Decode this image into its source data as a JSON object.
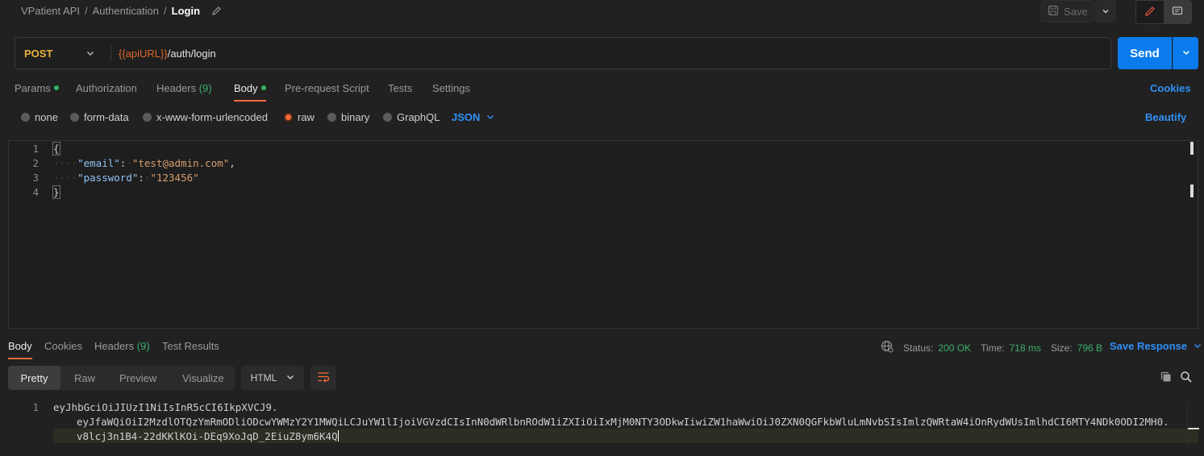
{
  "breadcrumb": {
    "workspace": "VPatient API",
    "folder": "Authentication",
    "request": "Login"
  },
  "toolbar": {
    "save_label": "Save"
  },
  "request": {
    "method": "POST",
    "url_variable": "{{apiURL}}",
    "url_path": "/auth/login",
    "send_label": "Send"
  },
  "request_tabs": {
    "params": "Params",
    "authorization": "Authorization",
    "headers": "Headers",
    "headers_count": "(9)",
    "body": "Body",
    "pre_request": "Pre-request Script",
    "tests": "Tests",
    "settings": "Settings",
    "cookies": "Cookies"
  },
  "body_types": {
    "none": "none",
    "form_data": "form-data",
    "urlencoded": "x-www-form-urlencoded",
    "raw": "raw",
    "binary": "binary",
    "graphql": "GraphQL",
    "selected": "raw",
    "language": "JSON",
    "beautify": "Beautify"
  },
  "editor": {
    "line_numbers": [
      "1",
      "2",
      "3",
      "4"
    ],
    "open_brace": "{",
    "close_brace": "}",
    "email_key": "\"email\"",
    "email_value": "\"test@admin.com\"",
    "password_key": "\"password\"",
    "password_value": "\"123456\""
  },
  "response_tabs": {
    "body": "Body",
    "cookies": "Cookies",
    "headers": "Headers",
    "headers_count": "(9)",
    "test_results": "Test Results"
  },
  "response_status": {
    "status_label": "Status:",
    "status_value": "200 OK",
    "time_label": "Time:",
    "time_value": "718 ms",
    "size_label": "Size:",
    "size_value": "796 B",
    "save_response": "Save Response"
  },
  "view_modes": {
    "pretty": "Pretty",
    "raw": "Raw",
    "preview": "Preview",
    "visualize": "Visualize",
    "format": "HTML"
  },
  "response_body": {
    "line_number": "1",
    "line1": "eyJhbGciOiJIUzI1NiIsInR5cCI6IkpXVCJ9.",
    "line2": "eyJfaWQiOiI2MzdlOTQzYmRmODliODcwYWMzY2Y1MWQiLCJuYW1lIjoiVGVzdCIsInN0dWRlbnROdW1iZXIiOiIxMjM0NTY3ODkwIiwiZW1haWwiOiJ0ZXN0QGFkbWluLmNvbSIsImlzQWRtaW4iOnRydWUsImlhdCI6MTY4NDk0ODI2MH0.",
    "line3": "v8lcj3n1B4-22dKKlKOi-DEq9XoJqD_2EiuZ8ym6K4Q"
  },
  "colors": {
    "accent_orange": "#ff6c37",
    "send_blue": "#097bed",
    "link_blue": "#2f8ff6",
    "status_green": "#3bb06b",
    "method_yellow": "#e8b23b"
  }
}
